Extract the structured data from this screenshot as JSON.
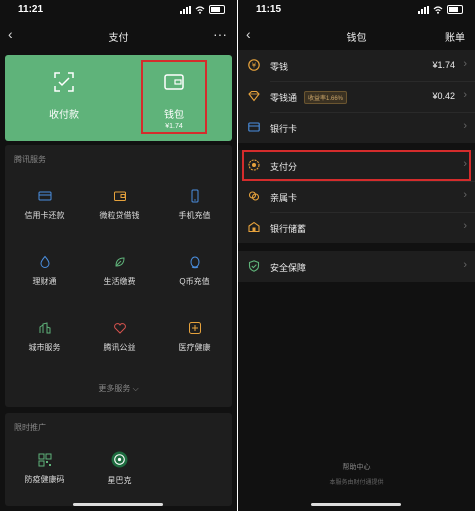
{
  "left": {
    "status": {
      "time": "11:21"
    },
    "title": "支付",
    "top": {
      "collect_label": "收付款",
      "wallet_label": "钱包",
      "wallet_amount": "¥1.74"
    },
    "tencent_services": {
      "heading": "腾讯服务",
      "items": [
        {
          "label": "信用卡还款",
          "icon": "credit-card-icon"
        },
        {
          "label": "微粒贷借钱",
          "icon": "loan-wallet-icon"
        },
        {
          "label": "手机充值",
          "icon": "phone-icon"
        },
        {
          "label": "理财通",
          "icon": "finance-drop-icon"
        },
        {
          "label": "生活缴费",
          "icon": "leaf-icon"
        },
        {
          "label": "Q币充值",
          "icon": "qq-penguin-icon"
        },
        {
          "label": "城市服务",
          "icon": "city-icon"
        },
        {
          "label": "腾讯公益",
          "icon": "charity-heart-icon"
        },
        {
          "label": "医疗健康",
          "icon": "medical-cross-icon"
        }
      ],
      "more_label": "更多服务 ⌵"
    },
    "promotions": {
      "heading": "限时推广",
      "items": [
        {
          "label": "防疫健康码",
          "icon": "qr-code-icon"
        },
        {
          "label": "星巴克",
          "icon": "starbucks-logo-icon"
        }
      ]
    }
  },
  "right": {
    "status": {
      "time": "11:15"
    },
    "title": "钱包",
    "bill_label": "账单",
    "rows_group1": [
      {
        "label": "零钱",
        "value": "¥1.74",
        "icon": "coin-icon"
      },
      {
        "label": "零钱通",
        "badge": "收益率1.66%",
        "value": "¥0.42",
        "icon": "diamond-icon"
      },
      {
        "label": "银行卡",
        "value": "",
        "icon": "bank-card-icon"
      }
    ],
    "rows_group2": [
      {
        "label": "支付分",
        "icon": "pay-score-icon"
      },
      {
        "label": "亲属卡",
        "icon": "family-card-icon"
      },
      {
        "label": "银行储蓄",
        "icon": "savings-icon"
      }
    ],
    "rows_group3": [
      {
        "label": "安全保障",
        "icon": "shield-icon"
      }
    ],
    "footer": {
      "help": "帮助中心",
      "provider": "本服务由财付通提供"
    }
  },
  "colors": {
    "background": "#111111",
    "card": "#1e1e1e",
    "green": "#5fb37a",
    "highlight_red": "#d42c2c",
    "accent_orange": "#e6a23c"
  }
}
